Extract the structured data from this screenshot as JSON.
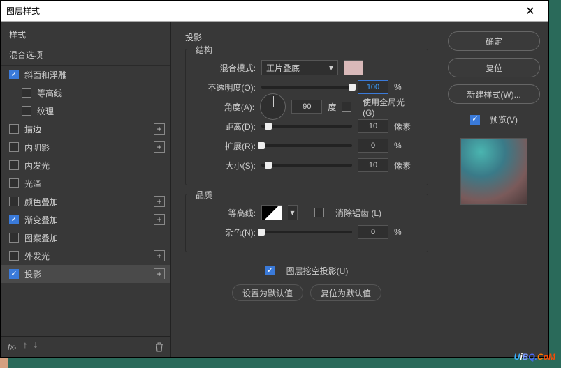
{
  "title": "图层样式",
  "left": {
    "header": "样式",
    "subheader": "混合选项",
    "items": [
      {
        "label": "斜面和浮雕",
        "checked": true,
        "plus": false,
        "sub": false
      },
      {
        "label": "等高线",
        "checked": false,
        "plus": false,
        "sub": true
      },
      {
        "label": "纹理",
        "checked": false,
        "plus": false,
        "sub": true
      },
      {
        "label": "描边",
        "checked": false,
        "plus": true,
        "sub": false
      },
      {
        "label": "内阴影",
        "checked": false,
        "plus": true,
        "sub": false
      },
      {
        "label": "内发光",
        "checked": false,
        "plus": false,
        "sub": false
      },
      {
        "label": "光泽",
        "checked": false,
        "plus": false,
        "sub": false
      },
      {
        "label": "颜色叠加",
        "checked": false,
        "plus": true,
        "sub": false
      },
      {
        "label": "渐变叠加",
        "checked": true,
        "plus": true,
        "sub": false
      },
      {
        "label": "图案叠加",
        "checked": false,
        "plus": false,
        "sub": false
      },
      {
        "label": "外发光",
        "checked": false,
        "plus": true,
        "sub": false
      },
      {
        "label": "投影",
        "checked": true,
        "plus": true,
        "sub": false,
        "selected": true
      }
    ]
  },
  "mid": {
    "panel_title": "投影",
    "grp1": {
      "title": "结构",
      "blend_label": "混合模式:",
      "blend_value": "正片叠底",
      "opacity_label": "不透明度(O):",
      "opacity": "100",
      "opacity_unit": "%",
      "angle_label": "角度(A):",
      "angle": "90",
      "angle_unit": "度",
      "global_chk": false,
      "global_label": "使用全局光 (G)",
      "dist_label": "距离(D):",
      "dist": "10",
      "dist_unit": "像素",
      "spread_label": "扩展(R):",
      "spread": "0",
      "spread_unit": "%",
      "size_label": "大小(S):",
      "size": "10",
      "size_unit": "像素"
    },
    "grp2": {
      "title": "品质",
      "contour_label": "等高线:",
      "aa_chk": false,
      "aa_label": "消除锯齿 (L)",
      "noise_label": "杂色(N):",
      "noise": "0",
      "noise_unit": "%"
    },
    "knock_chk": true,
    "knock_label": "图层挖空投影(U)",
    "btn_default": "设置为默认值",
    "btn_reset": "复位为默认值"
  },
  "right": {
    "ok": "确定",
    "cancel": "复位",
    "new": "新建样式(W)...",
    "preview_chk": true,
    "preview_label": "预览(V)"
  },
  "watermark": {
    "text": "UiBQ.CoM"
  }
}
